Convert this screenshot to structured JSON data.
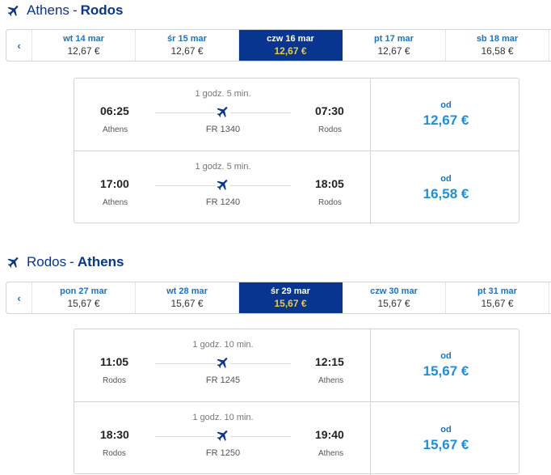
{
  "outbound": {
    "from": "Athens",
    "separator": "-",
    "to": "Rodos",
    "prev_arrow": "‹",
    "days": [
      {
        "label": "wt 14 mar",
        "price": "12,67 €"
      },
      {
        "label": "śr 15 mar",
        "price": "12,67 €"
      },
      {
        "label": "czw 16 mar",
        "price": "12,67 €"
      },
      {
        "label": "pt 17 mar",
        "price": "12,67 €"
      },
      {
        "label": "sb 18 mar",
        "price": "16,58 €"
      }
    ],
    "selected_index": 2,
    "flights": [
      {
        "dep_time": "06:25",
        "dep_city": "Athens",
        "duration": "1 godz. 5 min.",
        "flight_no": "FR 1340",
        "arr_time": "07:30",
        "arr_city": "Rodos",
        "from_label": "od",
        "price": "12,67 €"
      },
      {
        "dep_time": "17:00",
        "dep_city": "Athens",
        "duration": "1 godz. 5 min.",
        "flight_no": "FR 1240",
        "arr_time": "18:05",
        "arr_city": "Rodos",
        "from_label": "od",
        "price": "16,58 €"
      }
    ]
  },
  "return": {
    "from": "Rodos",
    "separator": "-",
    "to": "Athens",
    "prev_arrow": "‹",
    "days": [
      {
        "label": "pon 27 mar",
        "price": "15,67 €"
      },
      {
        "label": "wt 28 mar",
        "price": "15,67 €"
      },
      {
        "label": "śr 29 mar",
        "price": "15,67 €"
      },
      {
        "label": "czw 30 mar",
        "price": "15,67 €"
      },
      {
        "label": "pt 31 mar",
        "price": "15,67 €"
      }
    ],
    "selected_index": 2,
    "flights": [
      {
        "dep_time": "11:05",
        "dep_city": "Rodos",
        "duration": "1 godz. 10 min.",
        "flight_no": "FR 1245",
        "arr_time": "12:15",
        "arr_city": "Athens",
        "from_label": "od",
        "price": "15,67 €"
      },
      {
        "dep_time": "18:30",
        "dep_city": "Rodos",
        "duration": "1 godz. 10 min.",
        "flight_no": "FR 1250",
        "arr_time": "19:40",
        "arr_city": "Athens",
        "from_label": "od",
        "price": "15,67 €"
      }
    ]
  },
  "colors": {
    "brand": "#073590",
    "link": "#1a73c9",
    "price": "#1a8fe0",
    "selected_price": "#f1c933"
  },
  "icons": {
    "route": "plane-icon",
    "flight": "plane-icon"
  }
}
